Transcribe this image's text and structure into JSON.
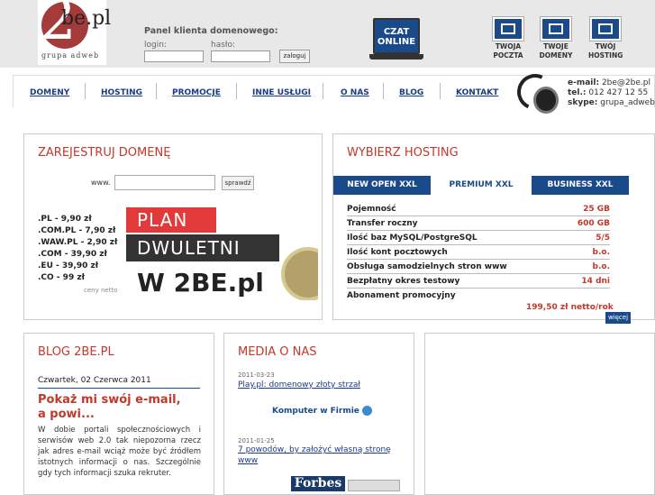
{
  "logo": {
    "big": "2",
    "sub": "be.pl",
    "tag": "grupa adweb"
  },
  "login": {
    "title": "Panel klienta domenowego:",
    "login_label": "login:",
    "pass_label": "hasło:",
    "button": "zaloguj"
  },
  "chat": {
    "line1": "CZAT",
    "line2": "ONLINE"
  },
  "quick": [
    {
      "l1": "TWOJA",
      "l2": "POCZTA"
    },
    {
      "l1": "TWOJE",
      "l2": "DOMENY"
    },
    {
      "l1": "TWÓJ",
      "l2": "HOSTING"
    }
  ],
  "nav": [
    "DOMENY",
    "HOSTING",
    "PROMOCJE",
    "INNE USŁUGI",
    "O NAS",
    "BLOG",
    "KONTAKT"
  ],
  "contact": {
    "email_label": "e-mail:",
    "email": "2be@2be.pl",
    "tel_label": "tel.:",
    "tel": "012 427 12 55",
    "skype_label": "skype:",
    "skype": "grupa_adweb"
  },
  "domain": {
    "title": "ZAREJESTRUJ DOMENĘ",
    "www": "www.",
    "check": "sprawdź",
    "netto": "ceny netto",
    "prices": [
      ".PL - 9,90 zł",
      ".COM.PL - 7,90 zł",
      ".WAW.PL - 2,90 zł",
      ".COM - 39,90 zł",
      ".EU - 39,90 zł",
      ".CO - 99 zł"
    ],
    "banner": {
      "l1": "PLAN",
      "l2": "DWULETNI",
      "l3": "W 2BE.pl"
    }
  },
  "hosting": {
    "title": "WYBIERZ HOSTING",
    "tabs": [
      "NEW OPEN XXL",
      "PREMIUM XXL",
      "BUSINESS XXL"
    ],
    "rows": [
      {
        "k": "Pojemność",
        "v": "25 GB"
      },
      {
        "k": "Transfer roczny",
        "v": "600 GB"
      },
      {
        "k": "Ilość baz MySQL/PostgreSQL",
        "v": "5/5"
      },
      {
        "k": "Ilość kont pocztowych",
        "v": "b.o."
      },
      {
        "k": "Obsługa samodzielnych stron www",
        "v": "b.o."
      },
      {
        "k": "Bezpłatny okres testowy",
        "v": "14 dni"
      },
      {
        "k": "Abonament promocyjny",
        "v": ""
      }
    ],
    "promo": "199,50 zł netto/rok",
    "more": "więcej"
  },
  "blog": {
    "title": "BLOG 2BE.PL",
    "date": "Czwartek, 02 Czerwca 2011",
    "post_title": "Pokaż mi swój e-mail, a powi...",
    "text": "W dobie portali społecznościowych i serwisów web 2.0 tak niepozorna rzecz jak adres e-mail wciąż może być źródłem istotnych informacji o nas. Szczególnie gdy tych informacji szuka rekruter."
  },
  "media": {
    "title": "MEDIA O NAS",
    "items": [
      {
        "date": "2011-03-23",
        "link": "Play.pl: domenowy złoty strzał",
        "logo": "Komputer w Firmie"
      },
      {
        "date": "2011-01-25",
        "link": "7 powodów, by założyć własną stronę www",
        "logo": "Forbes"
      }
    ]
  }
}
